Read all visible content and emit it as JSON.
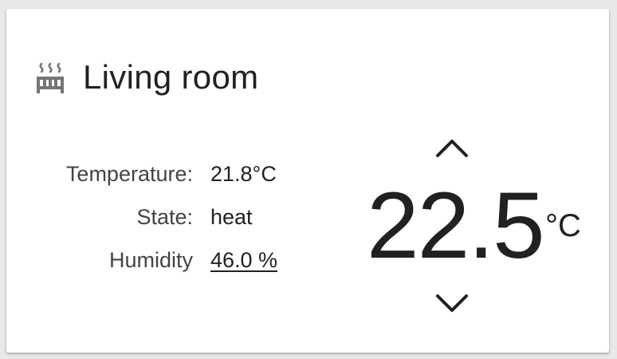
{
  "card": {
    "title": "Living room",
    "icon": "radiator-icon"
  },
  "attributes": [
    {
      "label": "Temperature:",
      "value": "21.8°C"
    },
    {
      "label": "State:",
      "value": "heat"
    },
    {
      "label": "Humidity",
      "value": "46.0 %"
    }
  ],
  "setpoint": {
    "value": "22.5",
    "unit": "°C"
  },
  "colors": {
    "text": "#212121",
    "icon": "#757575",
    "card_bg": "#ffffff",
    "page_bg": "#e8e8e8"
  }
}
